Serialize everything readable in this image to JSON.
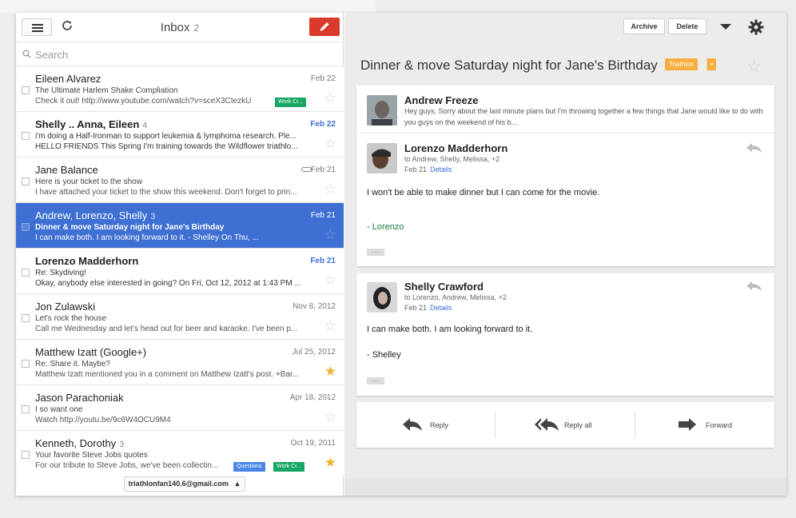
{
  "header": {
    "title": "Inbox",
    "count": "2"
  },
  "search": {
    "placeholder": "Search"
  },
  "emails": [
    {
      "sender": "Eileen Alvarez",
      "count": "",
      "date": "Feb 22",
      "subject": "The Ultimate Harlem Shake Compliation",
      "snippet": "Check it out! http://www.youtube.com/watch?v=sceX3CtezkU",
      "labels": [
        {
          "text": "Work Cr...",
          "color": "green"
        }
      ],
      "starred": false,
      "unread": false,
      "selected": false,
      "attachment": false
    },
    {
      "sender": "Shelly .. Anna, Eileen",
      "count": "4",
      "date": "Feb 22",
      "subject": "i'm doing a Half-Ironman to support leukemia & lymphoma research. Ple...",
      "snippet": "HELLO FRIENDS This Spring I'm training towards the Wildflower triathlo...",
      "labels": [],
      "starred": false,
      "unread": true,
      "selected": false,
      "attachment": false
    },
    {
      "sender": "Jane Balance",
      "count": "",
      "date": "Feb 21",
      "subject": "Here is your ticket to the show",
      "snippet": "I have attached your ticket to the show this weekend. Don't forget to prin...",
      "labels": [],
      "starred": false,
      "unread": false,
      "selected": false,
      "attachment": true
    },
    {
      "sender": "Andrew, Lorenzo, Shelly",
      "count": "3",
      "date": "Feb 21",
      "subject": "Dinner & move Saturday night for Jane's Birthday",
      "snippet": "I can make both. I am looking forward to it. - Shelley On Thu, ...",
      "labels": [],
      "starred": false,
      "unread": false,
      "selected": true,
      "attachment": false
    },
    {
      "sender": "Lorenzo Madderhorn",
      "count": "",
      "date": "Feb 21",
      "subject": "Re: Skydiving!",
      "snippet": "Okay, anybody else interested in going? On Fri, Oct 12, 2012 at 1:43 PM ...",
      "labels": [],
      "starred": false,
      "unread": true,
      "selected": false,
      "attachment": false
    },
    {
      "sender": "Jon Zulawski",
      "count": "",
      "date": "Nov 8, 2012",
      "subject": "Let's rock the house",
      "snippet": "Call me Wednesday and let's head out for beer and karaoke. I've been p...",
      "labels": [],
      "starred": false,
      "unread": false,
      "selected": false,
      "attachment": false
    },
    {
      "sender": "Matthew Izatt (Google+)",
      "count": "",
      "date": "Jul 25, 2012",
      "subject": "Re: Share it. Maybe?",
      "snippet": "Matthew Izatt mentioned you in a comment on Matthew Izatt's post. +Bar...",
      "labels": [],
      "starred": true,
      "unread": false,
      "selected": false,
      "attachment": false
    },
    {
      "sender": "Jason Parachoniak",
      "count": "",
      "date": "Apr 18, 2012",
      "subject": "I so want one",
      "snippet": "Watch http://youtu.be/9c6W4OCU9M4",
      "labels": [],
      "starred": false,
      "unread": false,
      "selected": false,
      "attachment": false
    },
    {
      "sender": "Kenneth, Dorothy",
      "count": "3",
      "date": "Oct 19, 2011",
      "subject": "Your favorite Steve Jobs quotes",
      "snippet": "For our tribute to Steve Jobs, we've been collectin...",
      "labels": [
        {
          "text": "Questions",
          "color": "blue"
        },
        {
          "text": "Work Cr...",
          "color": "green"
        }
      ],
      "starred": true,
      "unread": false,
      "selected": false,
      "attachment": false
    }
  ],
  "account": "triathlonfan140.6@gmail.com",
  "toolbar": {
    "archive": "Archive",
    "delete": "Delete"
  },
  "thread": {
    "title": "Dinner & move Saturday night for Jane's Birthday",
    "label": "Triathlon",
    "label_close": "×"
  },
  "messages": [
    {
      "name": "Andrew Freeze",
      "snippet": "Hey guys, Sorry about the last minute plans but I'm throwing together a few things that Jane would like to do with you guys on the weekend of his b..."
    },
    {
      "name": "Lorenzo Madderhorn",
      "to": "to Andrew, Shelly, Melissa, +2",
      "date": "Feb 21",
      "details": "Details",
      "body": "I won't be able to make dinner but I can come for the movie.",
      "signature": "- Lorenzo"
    },
    {
      "name": "Shelly Crawford",
      "to": "to Lorenzo, Andrew, Melissa, +2",
      "date": "Feb 21",
      "details": "Details",
      "body": "I can make both. I am looking forward to it.",
      "signature": "- Shelley"
    }
  ],
  "actions": {
    "reply": "Reply",
    "reply_all": "Reply all",
    "forward": "Forward"
  },
  "colors": {
    "selected_row": "#3e6fd2",
    "compose": "#d93a2b",
    "thread_label": "#f6ae3f",
    "star_on": "#f2b233"
  }
}
